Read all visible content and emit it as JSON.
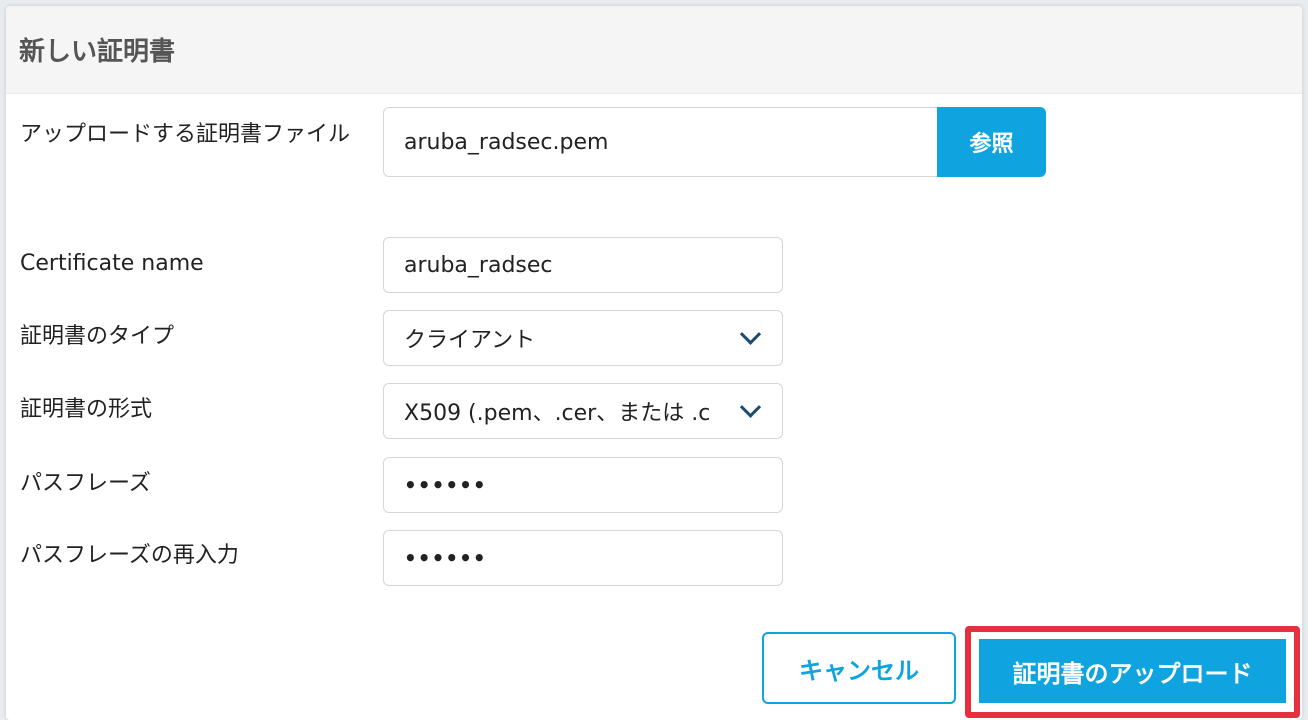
{
  "dialog": {
    "title": "新しい証明書"
  },
  "form": {
    "file": {
      "label": "アップロードする証明書ファイル",
      "value": "aruba_radsec.pem",
      "browse_label": "参照"
    },
    "name": {
      "label": "Certificate name",
      "value": "aruba_radsec"
    },
    "type": {
      "label": "証明書のタイプ",
      "selected": "クライアント"
    },
    "format": {
      "label": "証明書の形式",
      "selected": "X509 (.pem、.cer、または .c"
    },
    "passphrase": {
      "label": "パスフレーズ",
      "value": "••••••"
    },
    "passphrase_confirm": {
      "label": "パスフレーズの再入力",
      "value": "••••••"
    }
  },
  "footer": {
    "cancel_label": "キャンセル",
    "upload_label": "証明書のアップロード"
  },
  "colors": {
    "accent": "#0fa3e0",
    "highlight": "#e6303f",
    "chevron": "#1f4a6e"
  }
}
